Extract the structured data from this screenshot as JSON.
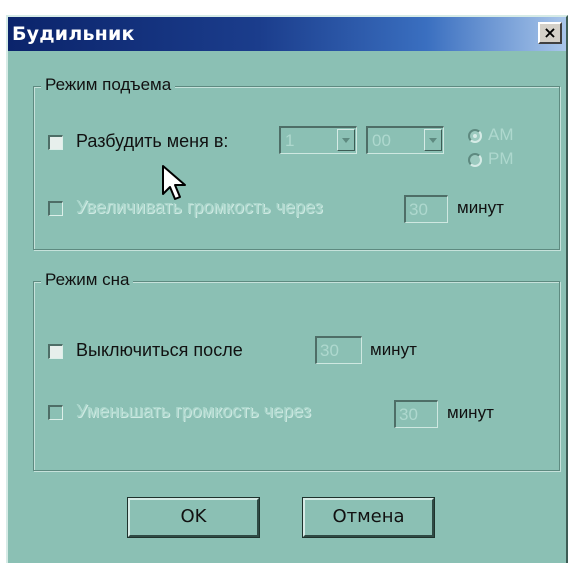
{
  "window": {
    "title": "Будильник",
    "close_label": "×"
  },
  "wake_group": {
    "legend": "Режим подъема",
    "wake_me": {
      "label": "Разбудить меня в:",
      "checked": false
    },
    "hour": {
      "value": "1"
    },
    "minute": {
      "value": "00"
    },
    "am": {
      "label": "AM",
      "selected": true
    },
    "pm": {
      "label": "PM",
      "selected": false
    },
    "increase": {
      "label": "Увеличивать громкость через",
      "value": "30",
      "unit": "минут",
      "enabled": false
    }
  },
  "sleep_group": {
    "legend": "Режим сна",
    "turn_off": {
      "label": "Выключиться после",
      "value": "30",
      "unit": "минут",
      "checked": false
    },
    "decrease": {
      "label": "Уменьшать громкость через",
      "value": "30",
      "unit": "минут",
      "enabled": false
    }
  },
  "buttons": {
    "ok": "OK",
    "cancel": "Отмена"
  },
  "colors": {
    "face": "#8bc0b4",
    "titlebar": "#0b246b",
    "text": "#111111",
    "disabled_text": "#a9d6cb"
  }
}
